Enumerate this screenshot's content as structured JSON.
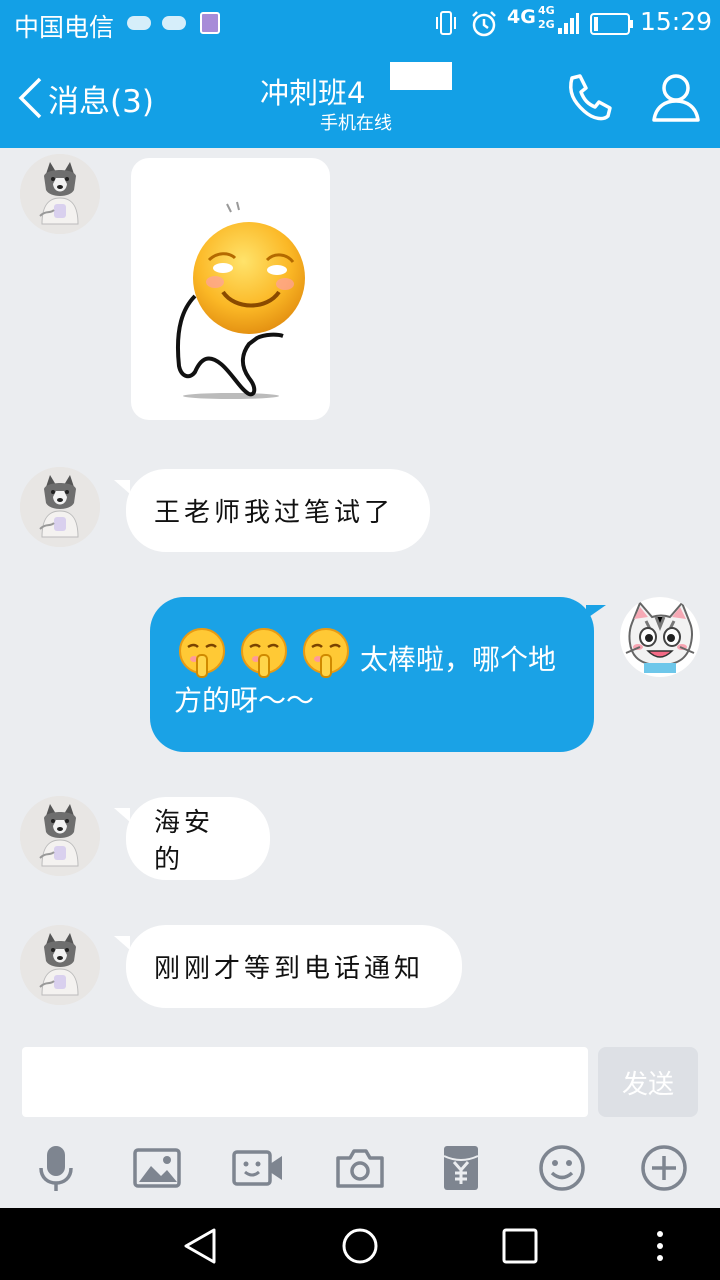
{
  "status_bar": {
    "carrier": "中国电信",
    "network_4g": "4G",
    "network_4g_small": "4G",
    "network_2g_small": "2G",
    "time": "15:29"
  },
  "header": {
    "back_label": "消息(3)",
    "title": "冲刺班4",
    "subtitle": "手机在线",
    "accent_color": "#13a0e6"
  },
  "messages": [
    {
      "sender": "incoming",
      "type": "sticker",
      "sticker": "dancing-smiley-sticker"
    },
    {
      "sender": "incoming",
      "type": "text",
      "text": "王老师我过笔试了"
    },
    {
      "sender": "outgoing",
      "type": "text",
      "emoji": [
        "applause-emoji",
        "applause-emoji",
        "applause-emoji"
      ],
      "text": "太棒啦，哪个地方的呀～～"
    },
    {
      "sender": "incoming",
      "type": "text",
      "text": "海安的"
    },
    {
      "sender": "incoming",
      "type": "text",
      "text": "刚刚才等到电话通知"
    }
  ],
  "composer": {
    "input_value": "",
    "send_label": "发送"
  },
  "toolbar": {
    "icons": [
      "microphone-icon",
      "image-icon",
      "video-call-icon",
      "camera-icon",
      "red-packet-icon",
      "emoji-icon",
      "plus-icon"
    ]
  },
  "navbar": {
    "icons": [
      "back-icon",
      "home-icon",
      "recents-icon",
      "menu-icon"
    ]
  }
}
